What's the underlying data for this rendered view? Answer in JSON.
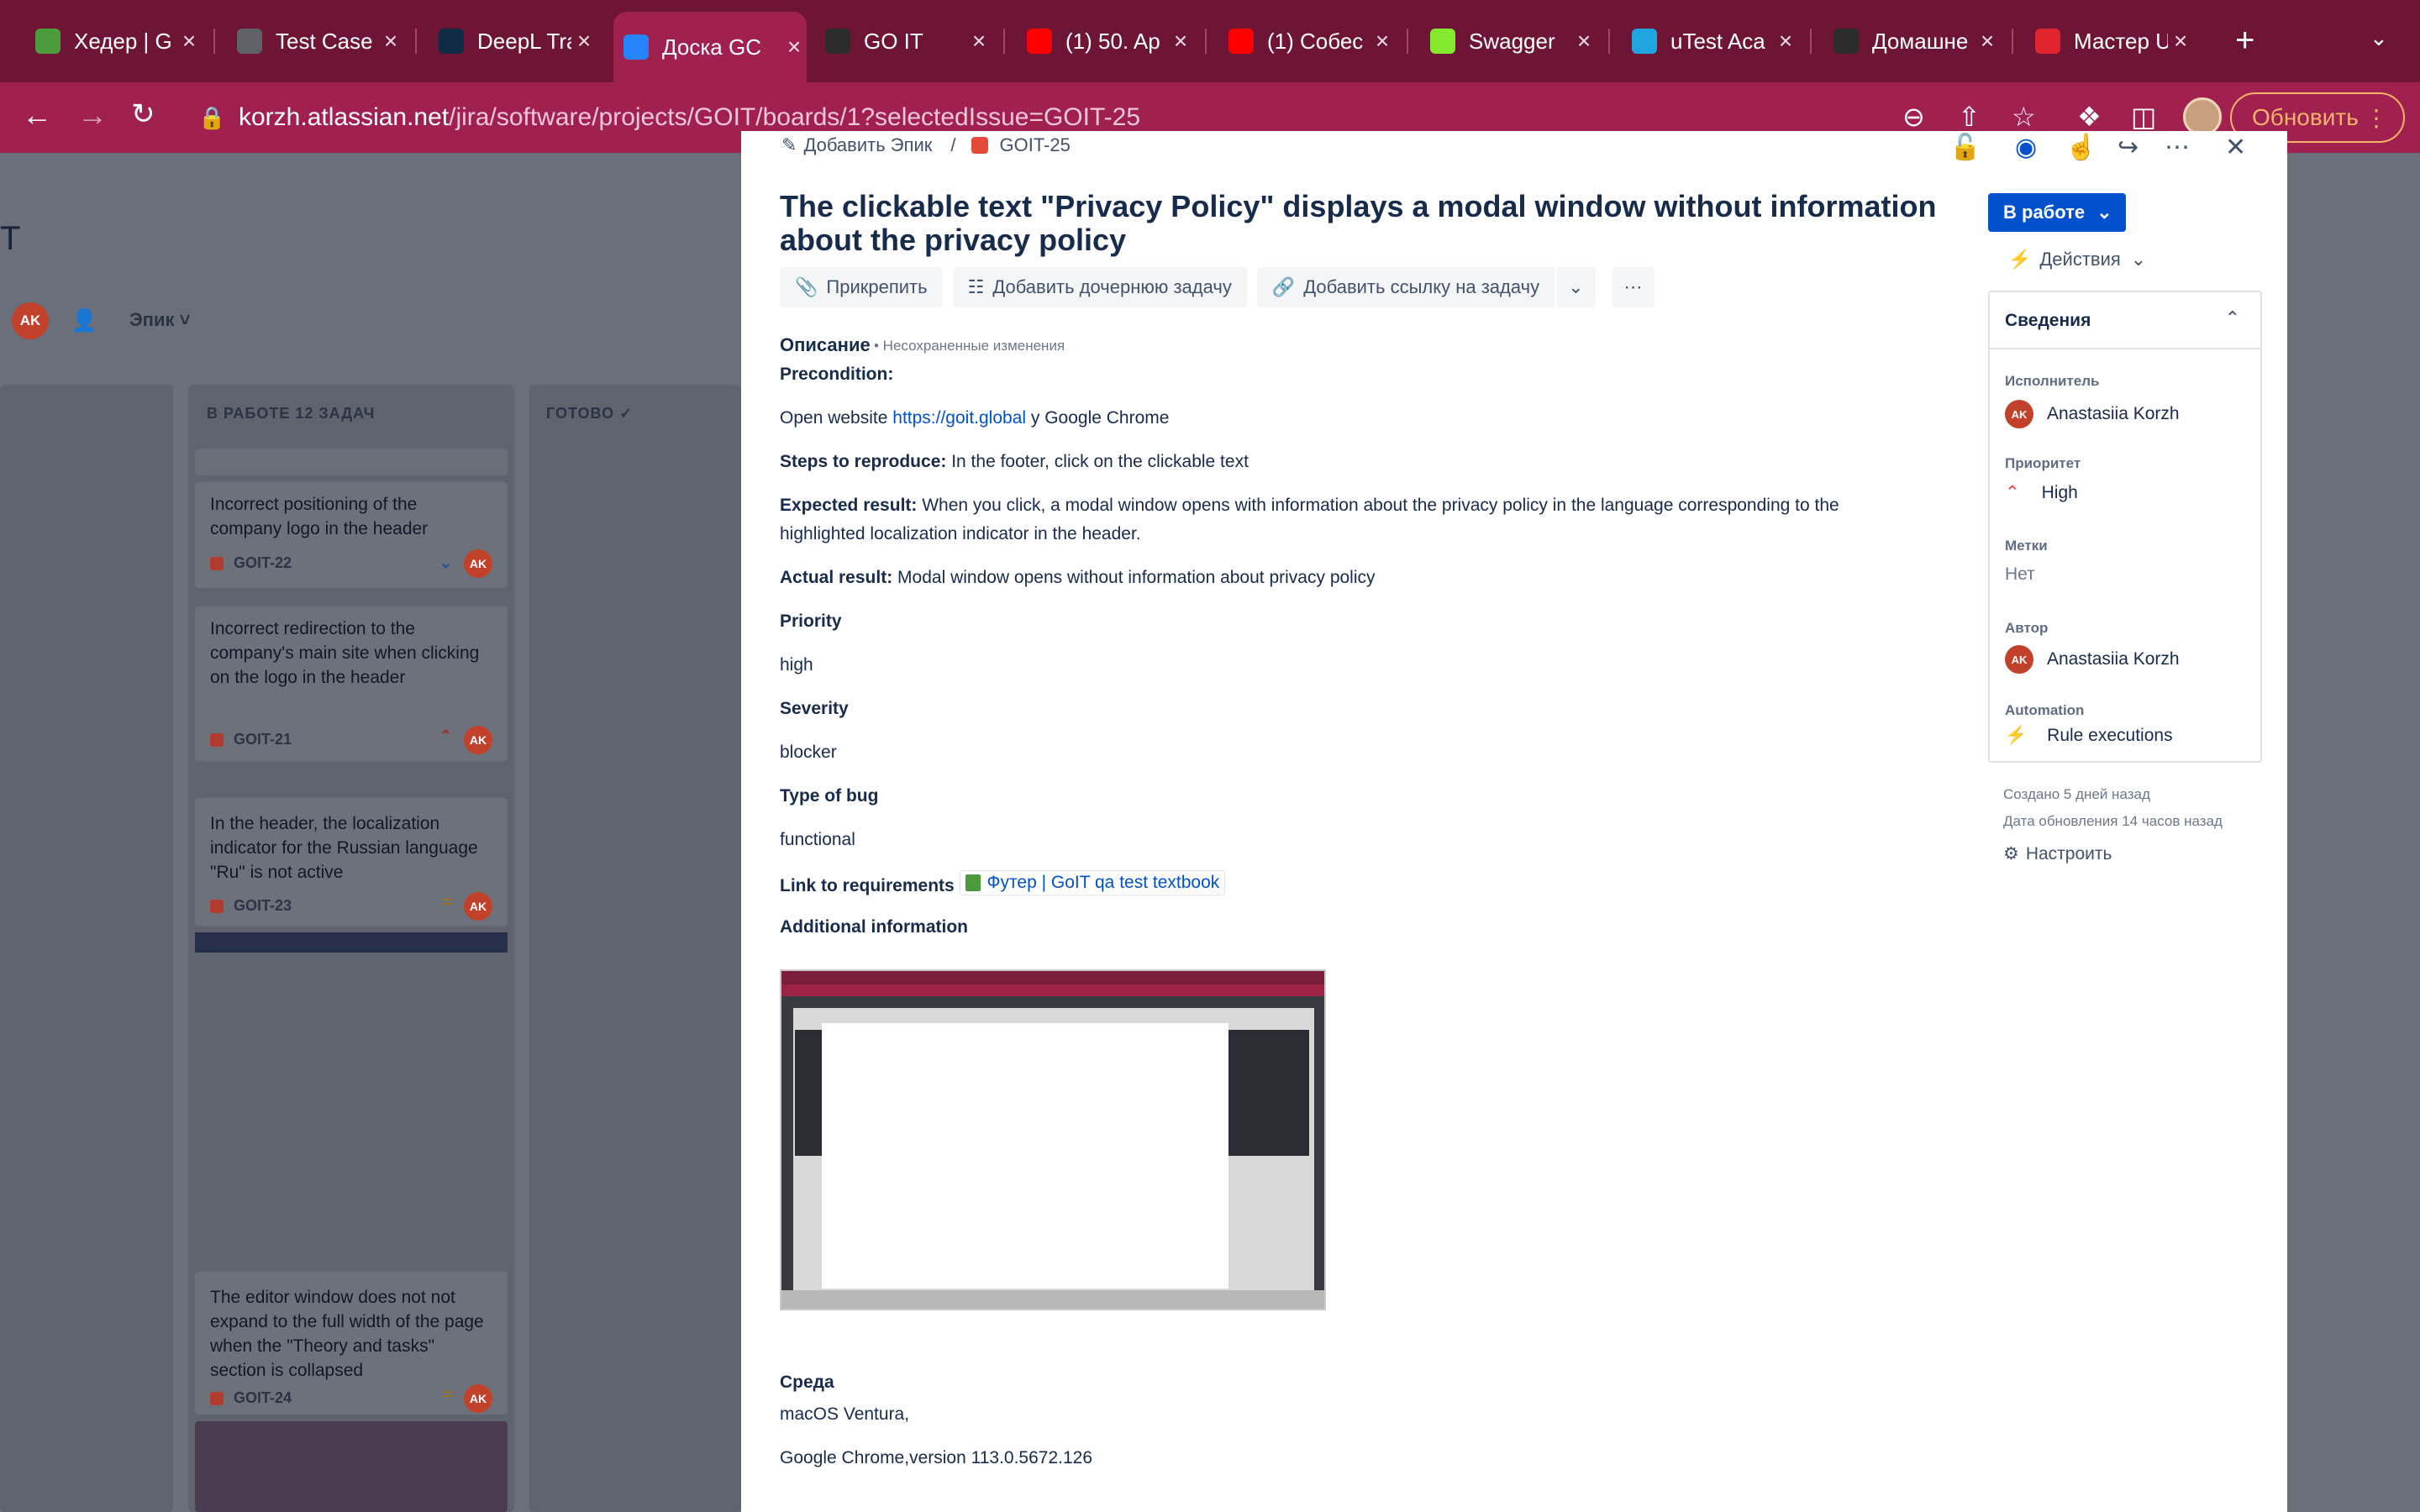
{
  "browser": {
    "tabs": [
      {
        "label": "Хедер | G",
        "favicon": "green-book-icon",
        "color": "#4b9a3c"
      },
      {
        "label": "Test Case",
        "favicon": "globe-icon",
        "color": "#5f6368"
      },
      {
        "label": "DeepL Tra",
        "favicon": "deepl-icon",
        "color": "#0f2b46"
      },
      {
        "label": "Доска GC",
        "favicon": "jira-icon",
        "color": "#2684ff"
      },
      {
        "label": "GO IT",
        "favicon": "goit-icon",
        "color": "#2c2c2c"
      },
      {
        "label": "(1) 50. Ap",
        "favicon": "youtube-icon",
        "color": "#ff0000"
      },
      {
        "label": "(1) Собес",
        "favicon": "youtube-icon",
        "color": "#ff0000"
      },
      {
        "label": "Swagger",
        "favicon": "swagger-icon",
        "color": "#85ea2d"
      },
      {
        "label": "uTest Aca",
        "favicon": "utest-icon",
        "color": "#1fa5e0"
      },
      {
        "label": "Домашне",
        "favicon": "goit-icon",
        "color": "#2c2c2c"
      },
      {
        "label": "Мастер U",
        "favicon": "codecademy-icon",
        "color": "#e0242e"
      }
    ],
    "url_host": "korzh.atlassian.net",
    "url_path": "/jira/software/projects/GOIT/boards/1?selectedIssue=GOIT-25",
    "update_label": "Обновить"
  },
  "board": {
    "title_fragment": "T",
    "filter_avatar": "AK",
    "epic_filter": "Эпик",
    "columns": [
      {
        "title": "В РАБОТЕ 12 ЗАДАЧ"
      },
      {
        "title": "ГОТОВО"
      }
    ],
    "cards": [
      {
        "text": "Incorrect positioning of the company logo in the header",
        "key": "GOIT-22",
        "priority": "low",
        "assignee": "AK"
      },
      {
        "text": "Incorrect redirection to the company's main site when clicking on the logo in the header",
        "key": "GOIT-21",
        "priority": "highest",
        "assignee": "AK"
      },
      {
        "text": "In the header, the localization indicator for the Russian language \"Ru\" is not active",
        "key": "GOIT-23",
        "priority": "medium",
        "assignee": "AK"
      },
      {
        "text": "The editor window does not not expand to the full width of the page when the \"Theory and tasks\" section is collapsed",
        "key": "GOIT-24",
        "priority": "medium",
        "assignee": "AK"
      }
    ]
  },
  "issue": {
    "breadcrumb_epic": "Добавить Эпик",
    "breadcrumb_key": "GOIT-25",
    "title": "The clickable text \"Privacy Policy\" displays a modal window without information about the privacy policy",
    "toolbar": {
      "attach": "Прикрепить",
      "add_child": "Добавить дочернюю задачу",
      "add_link": "Добавить ссылку на задачу"
    },
    "description_label": "Описание",
    "unsaved_label": "• Несохраненные изменения",
    "precondition_label": "Precondition:",
    "open_website_prefix": "Open website",
    "open_website_link": "https://goit.global",
    "open_website_suffix": " у  Google Chrome",
    "steps_label": "Steps to reproduce:",
    "steps_text": " In the footer, click on the clickable text",
    "expected_label": "Expected result:",
    "expected_text_1": " When you click, a modal window opens with information about the privacy policy in the language corresponding to the",
    "expected_text_2": "highlighted localization indicator in the header.",
    "actual_label": "Actual result:",
    "actual_text": " Modal window opens without information about privacy policy",
    "priority_label": "Priority",
    "priority_value": "high",
    "severity_label": "Severity",
    "severity_value": "blocker",
    "type_label": "Type of bug",
    "type_value": "functional",
    "requirements_label": "Link to requirements",
    "requirements_link": "Футер | GoIT qa test textbook",
    "additional_label": "Additional information",
    "env_label": "Среда",
    "env_line_1": "macOS Ventura,",
    "env_line_2": " Google Chrome,version 113.0.5672.126"
  },
  "sidebar": {
    "status": "В работе",
    "actions": "Действия",
    "details_title": "Сведения",
    "assignee_label": "Исполнитель",
    "assignee_name": "Anastasiia Korzh",
    "assignee_initials": "AK",
    "priority_label": "Приоритет",
    "priority_value": "High",
    "labels_label": "Метки",
    "labels_value": "Нет",
    "author_label": "Автор",
    "author_name": "Anastasiia Korzh",
    "author_initials": "AK",
    "automation_label": "Automation",
    "automation_value": "Rule executions",
    "created": "Создано 5 дней назад",
    "updated": "Дата обновления 14 часов назад",
    "configure": "Настроить"
  },
  "colors": {
    "tabbar": "#6e1535",
    "active_tab": "#a0214f",
    "jira_blue": "#0052cc",
    "avatar_red": "#c2412b"
  }
}
